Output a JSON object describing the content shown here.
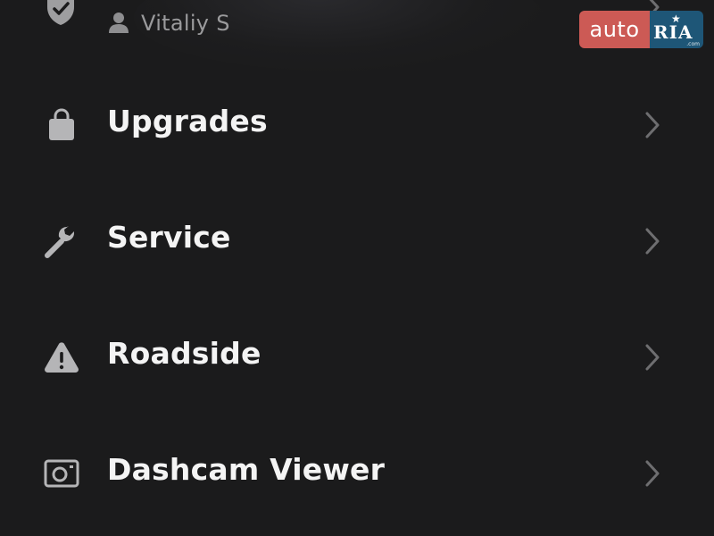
{
  "top": {
    "owner_name": "Vitaliy S"
  },
  "menu": {
    "items": [
      {
        "label": "Upgrades",
        "icon": "shopping-bag-icon"
      },
      {
        "label": "Service",
        "icon": "wrench-icon"
      },
      {
        "label": "Roadside",
        "icon": "warning-triangle-icon"
      },
      {
        "label": "Dashcam Viewer",
        "icon": "camera-icon"
      }
    ]
  },
  "watermark": {
    "auto": "auto",
    "ria": "RIA",
    "com": ".com"
  },
  "colors": {
    "background": "#1b1b1c",
    "label": "#f4f4f4",
    "icon": "#b5b5b7",
    "chevron": "#6e6e70",
    "muted_text": "#9a9a9c",
    "logo_red": "#cc5a55",
    "logo_blue": "#1e5677"
  }
}
